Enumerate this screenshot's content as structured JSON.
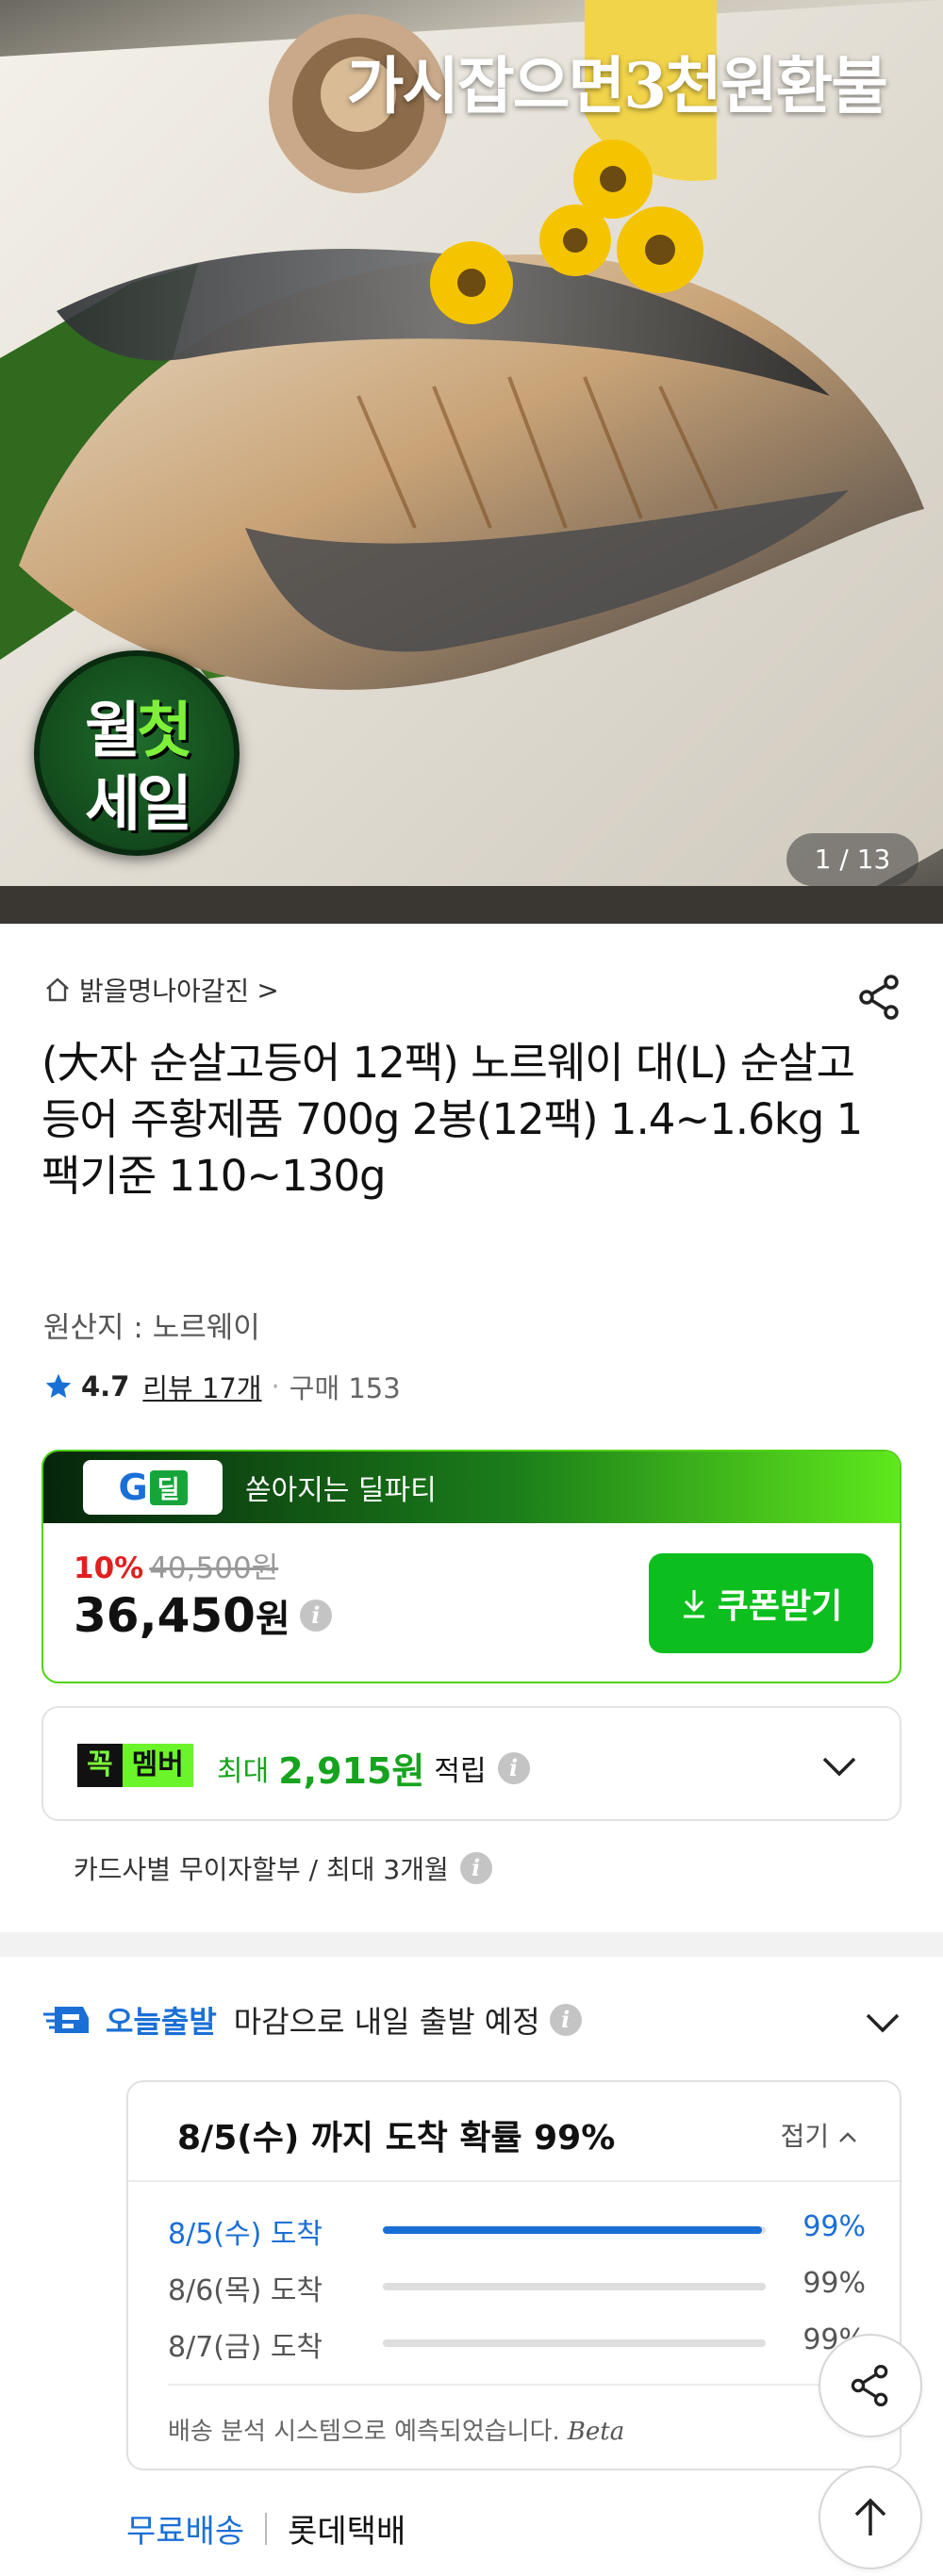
{
  "hero": {
    "watermark": "가시잡으면3천원환불",
    "badge_line1_a": "월",
    "badge_line1_b": "첫",
    "badge_line2": "세일",
    "counter": "1 / 13"
  },
  "product": {
    "breadcrumb": "밝을명나아갈진",
    "breadcrumb_chevron": ">",
    "title": "(大자 순살고등어 12팩) 노르웨이 대(L) 순살고등어 주황제품 700g 2봉(12팩) 1.4~1.6kg 1팩기준 110~130g",
    "origin": "원산지 : 노르웨이",
    "rating": "4.7",
    "reviews": "리뷰 17개",
    "dot": "·",
    "purchases": "구매 153"
  },
  "deal": {
    "logo_g": "G",
    "logo_d": "딜",
    "banner": "쏟아지는 딜파티",
    "discount": "10%",
    "original_price": "40,500원",
    "price": "36,450",
    "currency": "원",
    "coupon_button": "쿠폰받기"
  },
  "member": {
    "badge_k": "꼭",
    "badge_m": "멤버",
    "prefix": "최대",
    "amount": "2,915원",
    "suffix": "적립"
  },
  "installment": "카드사별 무이자할부 / 최대 3개월",
  "shipping": {
    "today_label": "오늘출발",
    "desc": "마감으로 내일 출발 예정",
    "eta_heading": "8/5(수) 까지 도착 확률 99%",
    "fold_label": "접기",
    "rows": [
      {
        "label": "8/5(수) 도착",
        "pct": "99%",
        "value": 0.99
      },
      {
        "label": "8/6(목) 도착",
        "pct": "99%",
        "value": 0.99
      },
      {
        "label": "8/7(금) 도착",
        "pct": "99%",
        "value": 0.99
      }
    ],
    "note": "배송 분석 시스템으로 예측되었습니다.",
    "beta": "Beta",
    "free": "무료배송",
    "carrier": "롯데택배"
  },
  "info_glyph": "i",
  "icons": [
    "home-icon",
    "share-icon",
    "star-icon",
    "info-icon",
    "download-icon",
    "chevron-down-icon",
    "chevron-up-icon",
    "truck-icon",
    "arrow-up-icon"
  ],
  "colors": {
    "accent_blue": "#1a6fd6",
    "deal_green": "#0cbf1e",
    "discount_red": "#e02020",
    "member_green": "#16a31e"
  }
}
